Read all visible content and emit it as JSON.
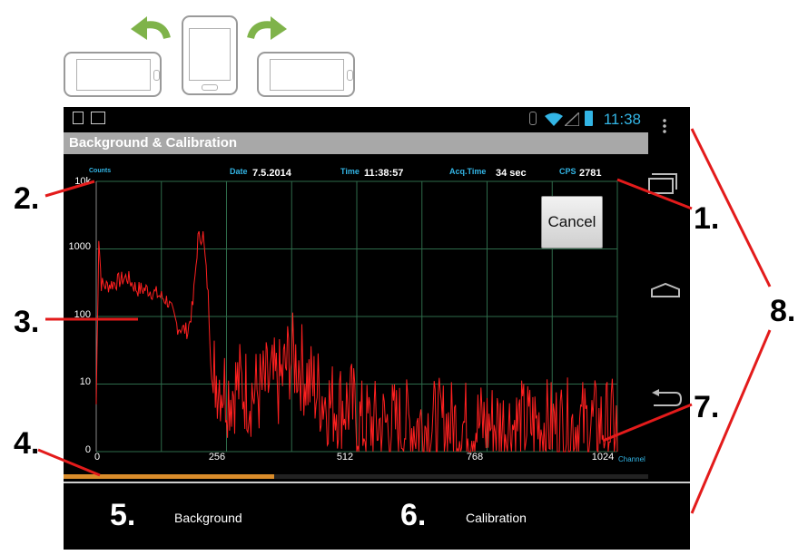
{
  "status_bar": {
    "clock": "11:38"
  },
  "app": {
    "title": "Background & Calibration"
  },
  "info": {
    "counts_label": "Counts",
    "date_label": "Date",
    "date_value": "7.5.2014",
    "time_label": "Time",
    "time_value": "11:38:57",
    "acq_label": "Acq.Time",
    "acq_value": "34 sec",
    "cps_label": "CPS",
    "cps_value": "2781"
  },
  "buttons": {
    "cancel": "Cancel"
  },
  "tabs": {
    "background": "Background",
    "calibration": "Calibration"
  },
  "progress": {
    "fraction": 0.36
  },
  "callouts": [
    "1.",
    "2.",
    "3.",
    "4.",
    "5.",
    "6.",
    "7.",
    "8."
  ],
  "colors": {
    "trace": "#ff2020",
    "accent": "#33b5e5",
    "progress": "#d98c2b",
    "grid": "#2e6b4a"
  },
  "chart_data": {
    "type": "line",
    "y_scale": "log",
    "ylim": [
      0,
      10000
    ],
    "xlim": [
      0,
      1024
    ],
    "y_ticks": [
      "10k",
      "1000",
      "100",
      "10",
      "0"
    ],
    "x_ticks": [
      "0",
      "256",
      "512",
      "768",
      "1024"
    ],
    "ylabel": "Counts",
    "xlabel": "Channel",
    "series": [
      {
        "x": [
          0,
          5,
          10,
          20,
          40,
          60,
          80,
          100,
          120,
          140,
          160,
          180,
          190,
          200,
          210,
          220,
          225,
          230,
          240,
          250,
          260,
          280,
          300,
          320,
          340,
          360,
          380,
          400,
          420,
          440,
          460,
          480,
          500,
          520,
          540,
          560,
          600,
          650,
          700,
          750,
          800,
          850,
          900,
          950,
          1000,
          1024
        ],
        "y": [
          5,
          1500,
          300,
          280,
          320,
          380,
          250,
          250,
          210,
          170,
          70,
          60,
          150,
          1400,
          1600,
          200,
          25,
          6,
          5,
          4,
          3,
          4,
          3,
          3,
          4,
          4,
          10,
          8,
          4,
          3,
          2,
          2,
          2,
          1,
          1,
          1,
          1,
          1,
          1,
          1,
          1,
          1,
          1,
          1,
          1,
          1
        ]
      }
    ]
  }
}
